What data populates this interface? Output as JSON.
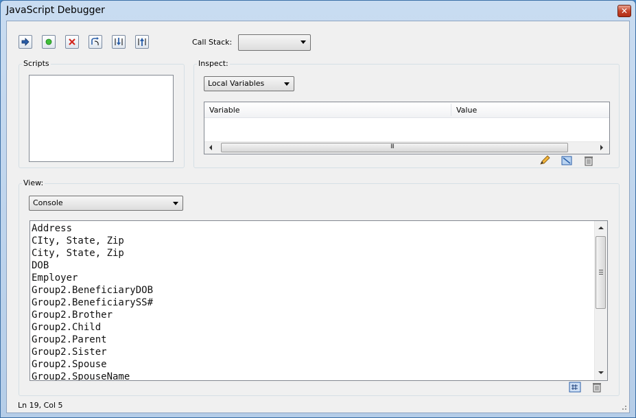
{
  "window": {
    "title": "JavaScript Debugger",
    "close_glyph": "✕"
  },
  "toolbar": {
    "buttons": [
      {
        "name": "step-arrow-icon"
      },
      {
        "name": "run-icon"
      },
      {
        "name": "stop-icon"
      },
      {
        "name": "step-over-icon"
      },
      {
        "name": "step-into-icon"
      },
      {
        "name": "step-out-icon"
      }
    ],
    "call_stack_label": "Call Stack:",
    "call_stack_value": ""
  },
  "scripts": {
    "title": "Scripts"
  },
  "inspect": {
    "title": "Inspect:",
    "dropdown_value": "Local Variables",
    "columns": [
      "Variable",
      "Value"
    ],
    "scroll_grip": "III",
    "action_icons": [
      "edit-icon",
      "watch-icon",
      "delete-icon"
    ]
  },
  "view": {
    "title": "View:",
    "dropdown_value": "Console",
    "console_lines": [
      "Address",
      "CIty, State, Zip",
      "City, State, Zip",
      "DOB",
      "Employer",
      "Group2.BeneficiaryDOB",
      "Group2.BeneficiarySS#",
      "Group2.Brother",
      "Group2.Child",
      "Group2.Parent",
      "Group2.Sister",
      "Group2.Spouse",
      "Group2.SpouseName"
    ],
    "action_icons": [
      "evaluate-icon",
      "clear-icon"
    ]
  },
  "status": {
    "text": "Ln 19, Col 5"
  }
}
